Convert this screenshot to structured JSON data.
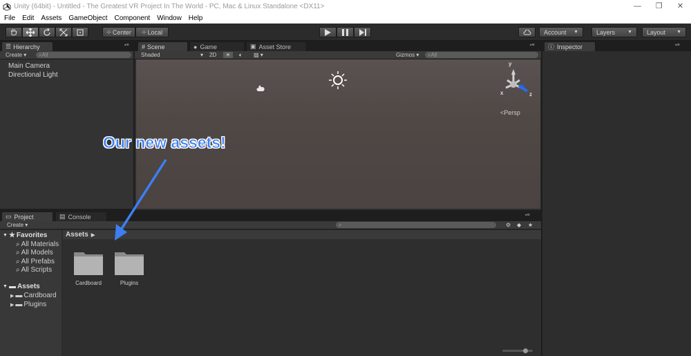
{
  "window": {
    "title": "Unity (64bit) - Untitled - The Greatest VR Project In The World - PC, Mac & Linux Standalone <DX11>",
    "controls": [
      "—",
      "❐",
      "✕"
    ]
  },
  "menu": [
    "File",
    "Edit",
    "Assets",
    "GameObject",
    "Component",
    "Window",
    "Help"
  ],
  "toolbar": {
    "pivot_label": "Center",
    "space_label": "Local",
    "account_label": "Account",
    "layers_label": "Layers",
    "layout_label": "Layout"
  },
  "hierarchy": {
    "tab_label": "Hierarchy",
    "create_label": "Create",
    "search_placeholder": "All",
    "items": [
      "Main Camera",
      "Directional Light"
    ]
  },
  "scene": {
    "tabs": [
      "Scene",
      "Game",
      "Asset Store"
    ],
    "shading_label": "Shaded",
    "mode_2d_label": "2D",
    "gizmos_label": "Gizmos",
    "search_placeholder": "All",
    "persp_label": "Persp",
    "axis_labels": {
      "y": "y",
      "x": "x",
      "z": "z"
    }
  },
  "inspector": {
    "tab_label": "Inspector"
  },
  "project": {
    "tabs": [
      "Project",
      "Console"
    ],
    "create_label": "Create",
    "favorites_label": "Favorites",
    "favorites": [
      "All Materials",
      "All Models",
      "All Prefabs",
      "All Scripts"
    ],
    "assets_label": "Assets",
    "asset_tree": [
      "Cardboard",
      "Plugins"
    ],
    "breadcrumb": "Assets",
    "folders": [
      "Cardboard",
      "Plugins"
    ]
  },
  "annotation": {
    "text": "Our new assets!"
  },
  "colors": {
    "scene_background": "#4e4745",
    "panel": "#333333",
    "callout": "#3d7ef0"
  }
}
